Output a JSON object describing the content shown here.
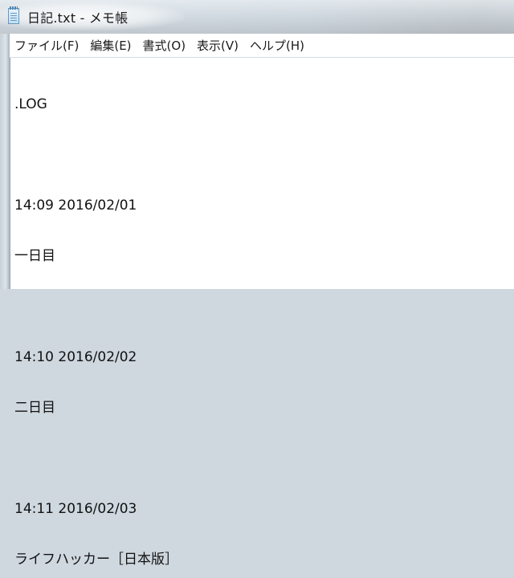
{
  "window": {
    "title": "日記.txt - メモ帳",
    "icon": "notepad-icon"
  },
  "menu": {
    "items": [
      {
        "label": "ファイル(F)"
      },
      {
        "label": "編集(E)"
      },
      {
        "label": "書式(O)"
      },
      {
        "label": "表示(V)"
      },
      {
        "label": "ヘルプ(H)"
      }
    ]
  },
  "editor": {
    "lines": [
      ".LOG",
      "",
      "14:09 2016/02/01",
      "一日目",
      "",
      "14:10 2016/02/02",
      "二日目",
      "",
      "14:11 2016/02/03",
      "ライフハッカー［日本版］"
    ]
  }
}
